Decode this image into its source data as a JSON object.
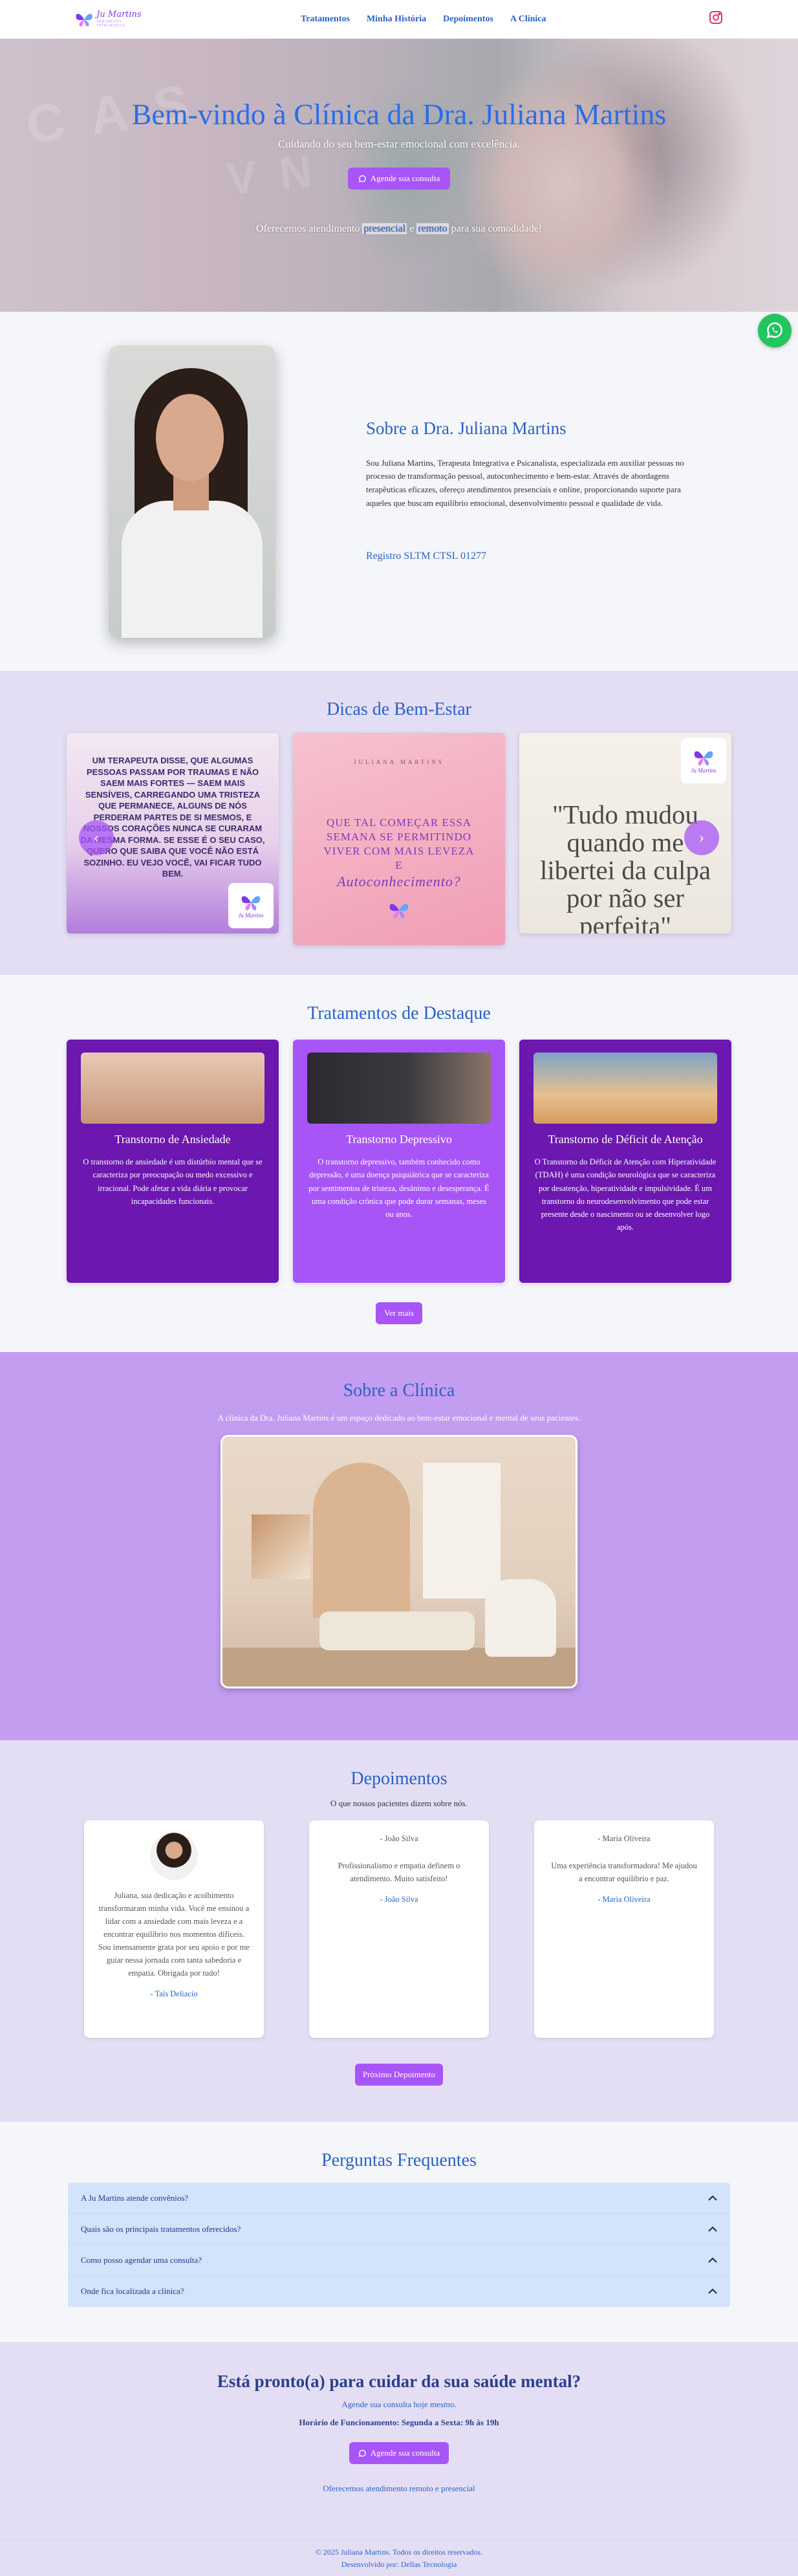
{
  "header": {
    "logo_name": "Ju Martins",
    "logo_sub": "TERAPEUTA INTEGRATIVA",
    "nav": [
      "Tratamentos",
      "Minha História",
      "Depoimentos",
      "A Clínica"
    ],
    "instagram_icon": "instagram-icon"
  },
  "hero": {
    "title": "Bem-vindo à Clínica da Dra. Juliana Martins",
    "subtitle": "Cuidando do seu bem-estar emocional com excelência.",
    "cta_label": "Agende sua consulta",
    "offer_prefix": "Oferecemos atendimento",
    "offer_presencial": "presencial",
    "offer_e": "e",
    "offer_remoto": "remoto",
    "offer_suffix": "para sua comodidade!"
  },
  "about": {
    "title": "Sobre a Dra. Juliana Martins",
    "text": "Sou Juliana Martins, Terapeuta Integrativa e Psicanalista, especializada em auxiliar pessoas no processo de transformação pessoal, autoconhecimento e bem-estar. Através de abordagens terapêuticas eficazes, ofereço atendimentos presenciais e online, proporcionando suporte para aqueles que buscam equilíbrio emocional, desenvolvimento pessoal e qualidade de vida.",
    "registration": "Registro SLTM CTSL 01277"
  },
  "tips": {
    "title": "Dicas de Bem-Estar",
    "card1": "Um terapeuta disse, que algumas pessoas passam por traumas e não saem mais fortes — saem mais sensíveis, carregando uma tristeza que permanece, alguns de nós perderam partes de si mesmos, e nossos corações nunca se curaram da mesma forma. Se esse é o seu caso, quero que saiba que você não está sozinho. Eu vejo você, vai ficar tudo bem.",
    "card2_small": "JULIANA MARTINS",
    "card2_big": "Que tal começar essa semana se permitindo viver com mais leveza e",
    "card2_italic": "Autoconhecimento?",
    "card3": "\"Tudo mudou quando me libertei da culpa por não ser perfeita\"",
    "logo_label": "Ju Martins"
  },
  "treatments": {
    "title": "Tratamentos de Destaque",
    "items": [
      {
        "title": "Transtorno de Ansiedade",
        "text": "O transtorno de ansiedade é um distúrbio mental que se caracteriza por preocupação ou medo excessivo e irracional. Pode afetar a vida diária e provocar incapacidades funcionais."
      },
      {
        "title": "Transtorno Depressivo",
        "text": "O transtorno depressivo, também conhecido como depressão, é uma doença psiquiátrica que se caracteriza por sentimentos de tristeza, desânimo e desesperança. É uma condição crônica que pode durar semanas, meses ou anos."
      },
      {
        "title": "Transtorno de Déficit de Atenção",
        "text": "O Transtorno do Déficit de Atenção com Hiperatividade (TDAH) é uma condição neurológica que se caracteriza por desatenção, hiperatividade e impulsividade. É um transtorno do neurodesenvolvimento que pode estar presente desde o nascimento ou se desenvolver logo após."
      }
    ],
    "more_label": "Ver mais"
  },
  "clinic": {
    "title": "Sobre a Clínica",
    "text": "A clínica da Dra. Juliana Martins é um espaço dedicado ao bem-estar emocional e mental de seus pacientes."
  },
  "testimonials": {
    "title": "Depoimentos",
    "lead": "O que nossos pacientes dizem sobre nós.",
    "items": [
      {
        "alt": "",
        "text": "Juliana, sua dedicação e acolhimento transformaram minha vida. Você me ensinou a lidar com a ansiedade com mais leveza e a encontrar equilíbrio nos momentos difíceis. Sou imensamente grata por seu apoio e por me guiar nessa jornada com tanta sabedoria e empatia. Obrigada por tudo!",
        "author": "- Taís Deliacio"
      },
      {
        "alt": "- João Silva",
        "text": "Profissionalismo e empatia definem o atendimento. Muito satisfeito!",
        "author": "- João Silva"
      },
      {
        "alt": "- Maria Oliveira",
        "text": "Uma experiência transformadora! Me ajudou a encontrar equilíbrio e paz.",
        "author": "- Maria Oliveira"
      }
    ],
    "next_label": "Próximo Depoimento"
  },
  "faq": {
    "title": "Perguntas Frequentes",
    "items": [
      "A Ju Martins atende convênios?",
      "Quais são os principais tratamentos oferecidos?",
      "Como posso agendar uma consulta?",
      "Onde fica localizada a clínica?"
    ]
  },
  "cta": {
    "title": "Está pronto(a) para cuidar da sua saúde mental?",
    "line1": "Agende sua consulta hoje mesmo.",
    "hours": "Horário de Funcionamento: Segunda a Sexta: 9h às 19h",
    "button": "Agende sua consulta",
    "line2": "Oferecemos atendimento remoto e presencial"
  },
  "footer": {
    "copyright": "© 2025 Juliana Martins. Todos os direitos reservados.",
    "dev": "Desenvolvido por: Dellas Tecnologia"
  },
  "colors": {
    "accent": "#a855f7",
    "deep_purple": "#6b17b0",
    "link_blue": "#2a62c4",
    "whatsapp": "#22c55e"
  }
}
